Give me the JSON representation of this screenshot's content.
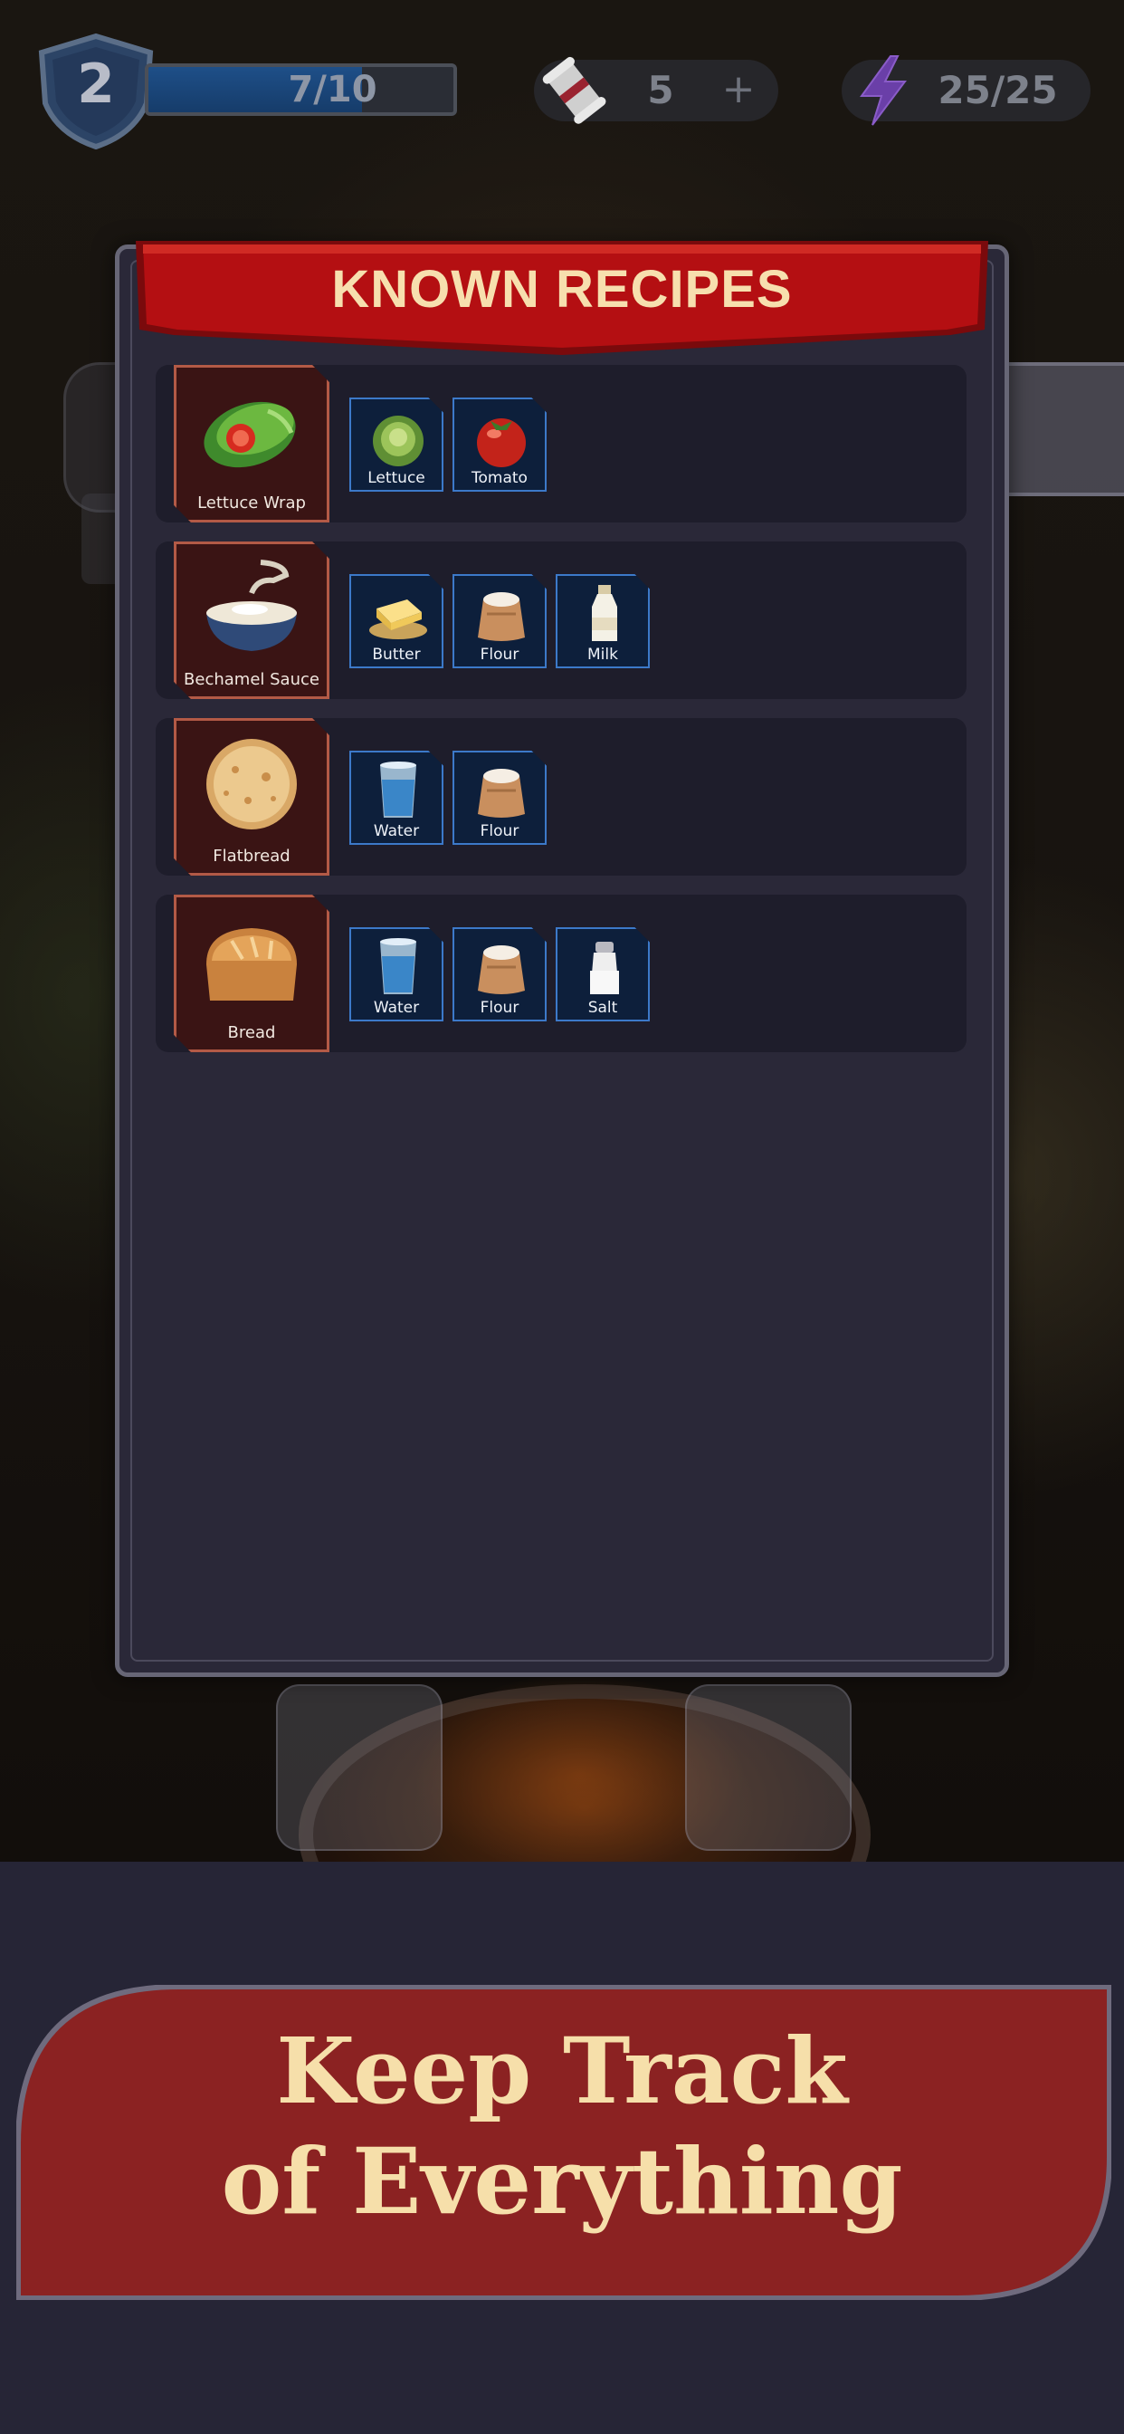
{
  "hud": {
    "level": "2",
    "xp_text": "7/10",
    "xp_progress": 0.7,
    "scrolls_count": "5",
    "plus_label": "+",
    "energy_text": "25/25"
  },
  "modal": {
    "title": "KNOWN RECIPES",
    "recipes": [
      {
        "name": "Lettuce Wrap",
        "icon": "lettuce-wrap-icon",
        "ingredients": [
          {
            "name": "Lettuce",
            "icon": "lettuce-icon"
          },
          {
            "name": "Tomato",
            "icon": "tomato-icon"
          }
        ]
      },
      {
        "name": "Bechamel Sauce",
        "icon": "bechamel-sauce-icon",
        "ingredients": [
          {
            "name": "Butter",
            "icon": "butter-icon"
          },
          {
            "name": "Flour",
            "icon": "flour-sack-icon"
          },
          {
            "name": "Milk",
            "icon": "milk-bottle-icon"
          }
        ]
      },
      {
        "name": "Flatbread",
        "icon": "flatbread-icon",
        "ingredients": [
          {
            "name": "Water",
            "icon": "water-glass-icon"
          },
          {
            "name": "Flour",
            "icon": "flour-sack-icon"
          }
        ]
      },
      {
        "name": "Bread",
        "icon": "bread-loaf-icon",
        "ingredients": [
          {
            "name": "Water",
            "icon": "water-glass-icon"
          },
          {
            "name": "Flour",
            "icon": "flour-sack-icon"
          },
          {
            "name": "Salt",
            "icon": "salt-shaker-icon"
          }
        ]
      }
    ]
  },
  "promo": {
    "line1": "Keep Track",
    "line2": "of Everything"
  },
  "colors": {
    "banner_red": "#b40f12",
    "promo_red": "#8b2222",
    "promo_text": "#f6dfaa",
    "dish_card_bg": "#3a1414",
    "ingredient_card_bg": "#0d1f3b",
    "ingredient_border": "#3c79c9"
  }
}
